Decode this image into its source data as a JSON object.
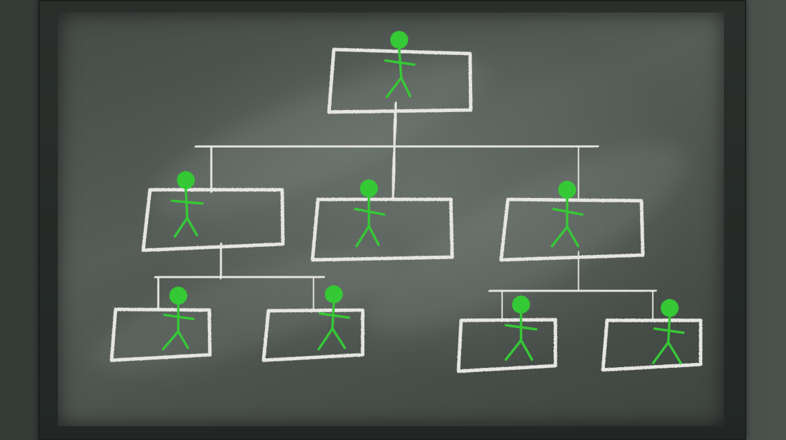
{
  "scene": {
    "subject": "org-chart-drawn-in-chalk-on-blackboard",
    "colors": {
      "chalk": "#e6e6e3",
      "figure": "#36c936",
      "board": "#4c524e",
      "frame": "#242927"
    },
    "levels": [
      {
        "level": 1,
        "boxes": 1
      },
      {
        "level": 2,
        "boxes": 3
      },
      {
        "level": 3,
        "boxes": 4
      }
    ]
  }
}
